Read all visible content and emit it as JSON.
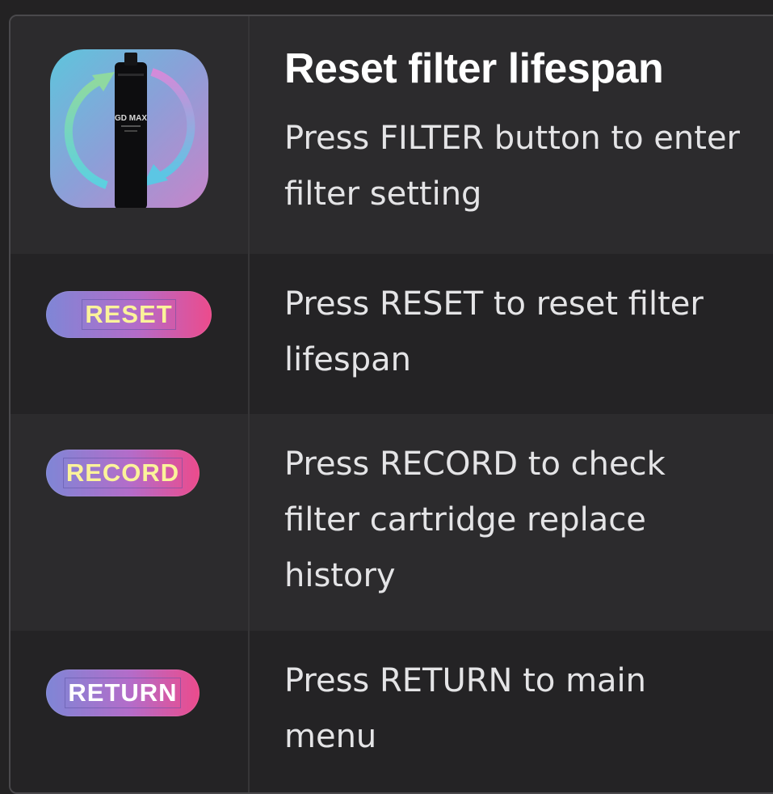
{
  "rows": [
    {
      "title": "Reset filter lifespan",
      "description": "Press FILTER button to enter\nfilter setting",
      "icon": "filter-cartridge-reset-icon",
      "device_brand": "GD MAX"
    },
    {
      "button_label": "RESET",
      "description": "Press RESET to reset filter\nlifespan"
    },
    {
      "button_label": "RECORD",
      "description": "Press RECORD to check\nfilter cartridge replace\nhistory"
    },
    {
      "button_label": "RETURN",
      "description": "Press RETURN to main\nmenu"
    }
  ],
  "colors": {
    "background": "#232223",
    "row_light": "#2c2b2d",
    "row_dark": "#242325",
    "pill_gradient_start": "#7f86d6",
    "pill_gradient_end": "#ec4b8c",
    "button_text_yellow": "#fbf39a"
  }
}
